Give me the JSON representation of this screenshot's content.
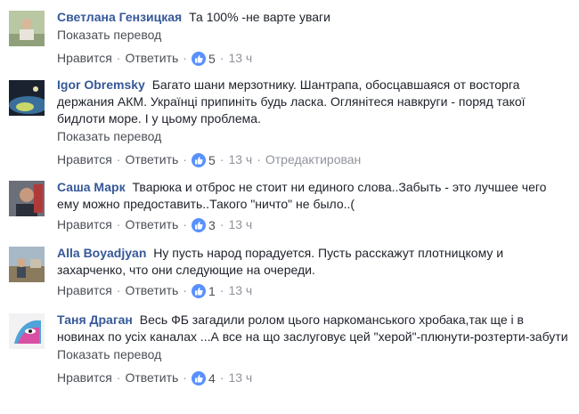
{
  "ui": {
    "like_label": "Нравится",
    "reply_label": "Ответить",
    "translate_label": "Показать перевод",
    "separator": "·",
    "accent_color": "#365899",
    "like_badge_color": "#5890ff",
    "like_icon": "thumbs-up-icon"
  },
  "comments": [
    {
      "author": "Светлана Гензицкая",
      "text": "Та 100% -не варте уваги",
      "likes": "5",
      "time": "13 ч",
      "edited": ""
    },
    {
      "author": "Igor Obremsky",
      "text": "Багато шани мерзотнику. Шантрапа, обосцавшаяся от восторга держания АКМ. Українці припиніть будь ласка. Оглянітеся навкруги - поряд такої бидлоти море. І у цьому проблема.",
      "likes": "5",
      "time": "13 ч",
      "edited": "Отредактирован"
    },
    {
      "author": "Саша Марк",
      "text": "Тварюка и отброс не стоит ни единого слова..Забыть - это лучшее чего ему можно предоставить..Такого \"ничто\" не было..(",
      "likes": "3",
      "time": "13 ч",
      "edited": ""
    },
    {
      "author": "Alla Boyadjyan",
      "text": "Ну пусть народ порадуется. Пусть расскажут плотницкому и захарченко, что они следующие на очереди.",
      "likes": "1",
      "time": "13 ч",
      "edited": ""
    },
    {
      "author": "Таня Драган",
      "text": "Весь ФБ загадили ролом цього наркоманського хробака,так ще і в новинах по усіх каналах ...А все на що заслуговує цей \"херой\"-плюнути-розтерти-забути",
      "likes": "4",
      "time": "13 ч",
      "edited": ""
    }
  ]
}
